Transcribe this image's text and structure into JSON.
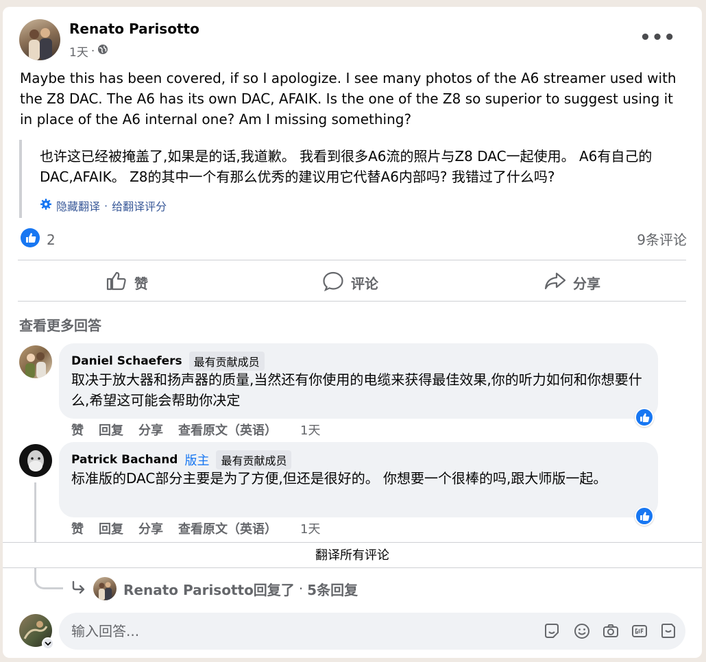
{
  "post": {
    "author": "Renato Parisotto",
    "time": "1天",
    "privacy_icon": "globe-icon",
    "more_label": "•••",
    "body": "Maybe this has been covered, if so I apologize. I see many photos of the A6 streamer used with the Z8 DAC. The A6 has its own DAC, AFAIK. Is the one of the Z8 so superior to suggest using it in place of the A6 internal one? Am I missing something?",
    "translation": "也许这已经被掩盖了,如果是的话,我道歉。 我看到很多A6流的照片与Z8 DAC一起使用。 A6有自己的DAC,AFAIK。 Z8的其中一个有那么优秀的建议用它代替A6内部吗? 我错过了什么吗?",
    "hide_translation": "隐藏翻译",
    "separator": "·",
    "rate_translation": "给翻译评分",
    "like_count": "2",
    "comment_count": "9条评论"
  },
  "actions": {
    "like": "赞",
    "comment": "评论",
    "share": "分享"
  },
  "comments_section": {
    "view_more": "查看更多回答",
    "comments": [
      {
        "name": "Daniel Schaefers",
        "role": "",
        "badge": "最有贡献成员",
        "text": "取决于放大器和扬声器的质量,当然还有你使用的电缆来获得最佳效果,你的听力如何和你想要什么,希望这可能会帮助你决定",
        "like": "赞",
        "reply": "回复",
        "share": "分享",
        "see_original": "查看原文（英语）",
        "time": "1天"
      },
      {
        "name": "Patrick Bachand",
        "role": "版主",
        "badge": "最有贡献成员",
        "text": "标准版的DAC部分主要是为了方便,但还是很好的。 你想要一个很棒的吗,跟大师版一起。",
        "like": "赞",
        "reply": "回复",
        "share": "分享",
        "see_original": "查看原文（英语）",
        "time": "1天"
      }
    ],
    "translate_all": "翻译所有评论",
    "reply_summary_name": "Renato Parisotto回复了",
    "reply_summary_sep": "·",
    "reply_summary_count": "5条回复"
  },
  "composer": {
    "placeholder": "输入回答...",
    "tools": [
      "sticker-icon",
      "emoji-icon",
      "camera-icon",
      "gif-icon",
      "sticker2-icon"
    ]
  },
  "colors": {
    "accent": "#1877f2",
    "secondary_text": "#65676b",
    "bubble": "#f0f2f5",
    "background": "#efe9e3"
  }
}
